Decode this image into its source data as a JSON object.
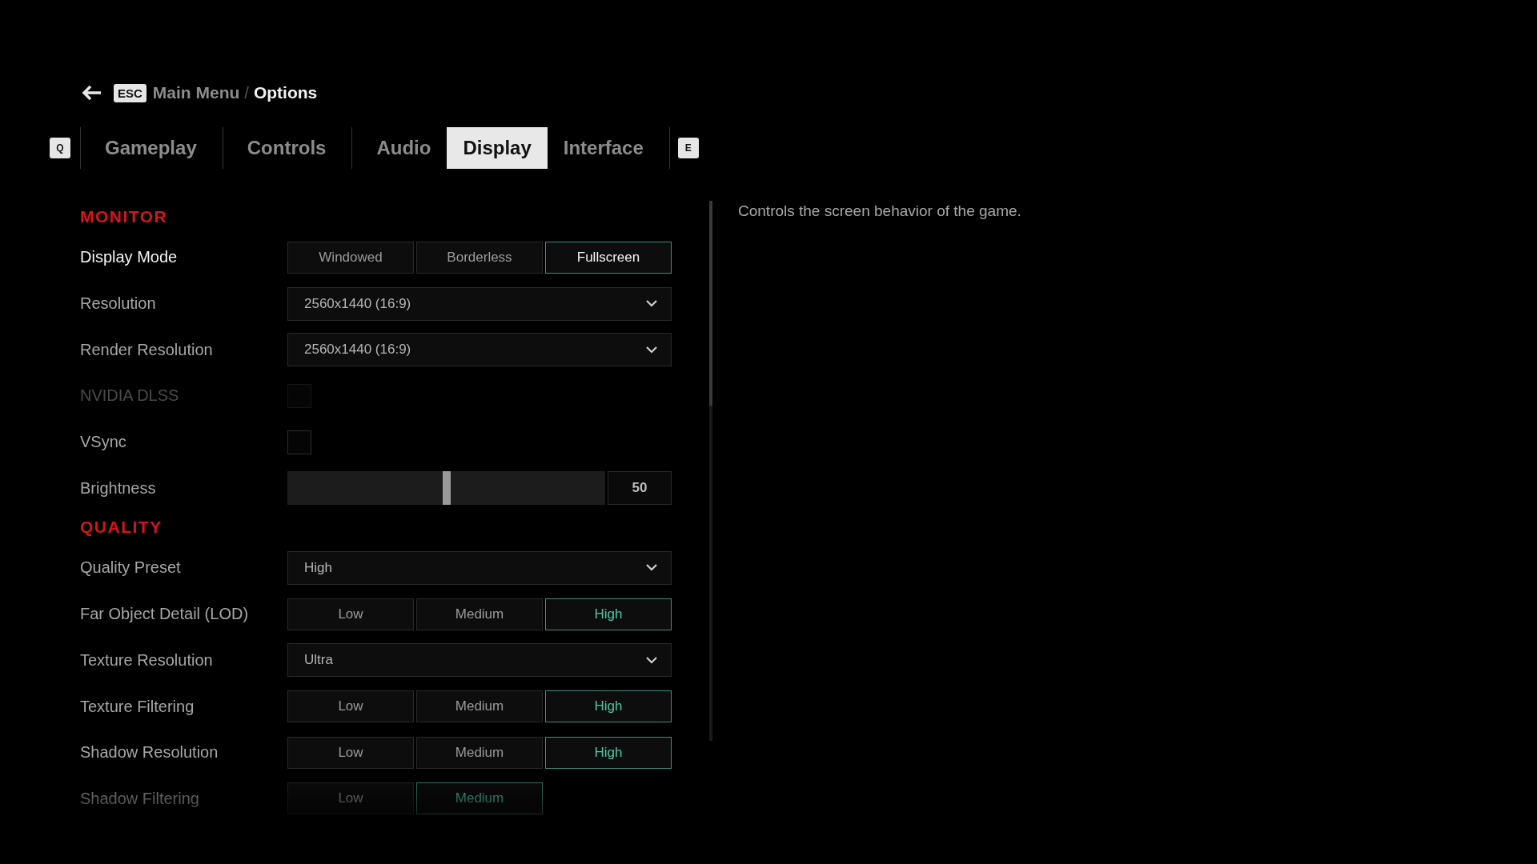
{
  "breadcrumb": {
    "key": "ESC",
    "items": [
      {
        "label": "Main Menu",
        "selected": false
      },
      {
        "label": "Options",
        "selected": true
      }
    ],
    "separator": "/"
  },
  "tabs": {
    "prev_key": "Q",
    "next_key": "E",
    "items": [
      {
        "label": "Gameplay",
        "selected": false
      },
      {
        "label": "Controls",
        "selected": false
      },
      {
        "label": "Audio",
        "selected": false
      },
      {
        "label": "Display",
        "selected": true
      },
      {
        "label": "Interface",
        "selected": false
      }
    ]
  },
  "sections": [
    {
      "title": "MONITOR",
      "settings": [
        {
          "kind": "options",
          "label": "Display Mode",
          "focused": true,
          "disabled": false,
          "options": [
            {
              "label": "Windowed",
              "selected": false
            },
            {
              "label": "Borderless",
              "selected": false
            },
            {
              "label": "Fullscreen",
              "selected": true
            }
          ]
        },
        {
          "kind": "dropdown",
          "label": "Resolution",
          "focused": false,
          "disabled": false,
          "value": "2560x1440 (16:9)"
        },
        {
          "kind": "dropdown",
          "label": "Render Resolution",
          "focused": false,
          "disabled": false,
          "value": "2560x1440 (16:9)"
        },
        {
          "kind": "checkbox",
          "label": "NVIDIA DLSS",
          "focused": false,
          "disabled": true,
          "checked": false
        },
        {
          "kind": "checkbox",
          "label": "VSync",
          "focused": false,
          "disabled": false,
          "checked": false
        },
        {
          "kind": "slider",
          "label": "Brightness",
          "focused": false,
          "disabled": false,
          "level": 0.5,
          "reading": "50"
        }
      ]
    },
    {
      "title": "QUALITY",
      "settings": [
        {
          "kind": "dropdown",
          "label": "Quality Preset",
          "focused": false,
          "disabled": false,
          "value": "High"
        },
        {
          "kind": "options",
          "label": "Far Object Detail (LOD)",
          "focused": false,
          "disabled": false,
          "options": [
            {
              "label": "Low",
              "selected": false
            },
            {
              "label": "Medium",
              "selected": false
            },
            {
              "label": "High",
              "selected": true
            }
          ]
        },
        {
          "kind": "dropdown",
          "label": "Texture Resolution",
          "focused": false,
          "disabled": false,
          "value": "Ultra"
        },
        {
          "kind": "options",
          "label": "Texture Filtering",
          "focused": false,
          "disabled": false,
          "options": [
            {
              "label": "Low",
              "selected": false
            },
            {
              "label": "Medium",
              "selected": false
            },
            {
              "label": "High",
              "selected": true
            }
          ]
        },
        {
          "kind": "options",
          "label": "Shadow Resolution",
          "focused": false,
          "disabled": false,
          "options": [
            {
              "label": "Low",
              "selected": false
            },
            {
              "label": "Medium",
              "selected": false
            },
            {
              "label": "High",
              "selected": true
            }
          ]
        },
        {
          "kind": "options",
          "label": "Shadow Filtering",
          "focused": false,
          "disabled": false,
          "options": [
            {
              "label": "Low",
              "selected": false
            },
            {
              "label": "Medium",
              "selected": true
            }
          ]
        }
      ]
    }
  ],
  "description": "Controls the screen behavior of the game."
}
